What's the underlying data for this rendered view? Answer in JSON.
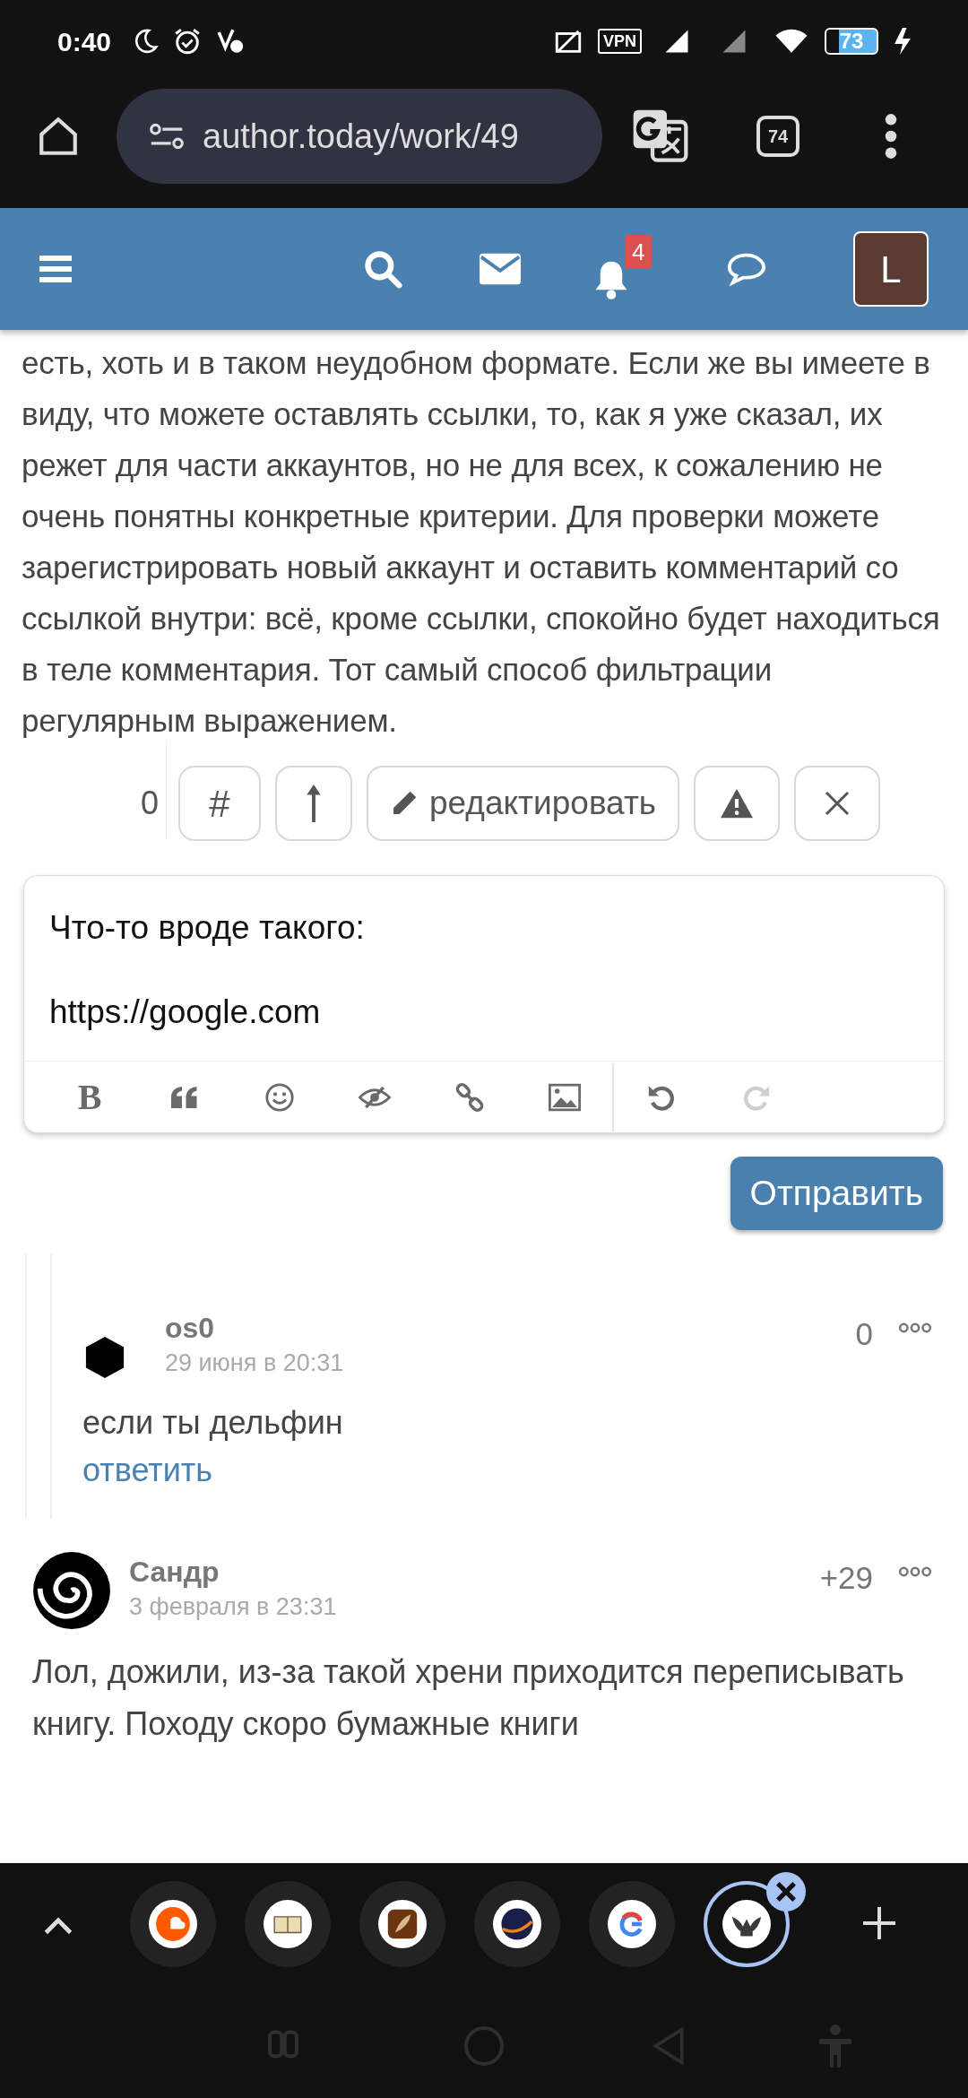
{
  "status_bar": {
    "time": "0:40",
    "vpn": "VPN",
    "battery": "73"
  },
  "browser": {
    "url": "author.today/work/49",
    "tab_count": "74"
  },
  "site_header": {
    "notification_count": "4",
    "avatar_letter": "L"
  },
  "comment_body": "есть, хоть и в таком неудобном формате. Если же вы имеете в виду, что можете оставлять ссылки, то, как я уже сказал, их режет для части аккаунтов, но не для всех, к сожалению не очень понятны конкретные критерии. Для проверки можете зарегистрировать новый аккаунт и оставить комментарий со ссылкой внутри: всё, кроме ссылки, спокойно будет находиться в теле комментария. Тот самый способ фильтрации регулярным выражением.",
  "actions": {
    "score": "0",
    "buttons": [
      {
        "kind": "hash",
        "label": "#"
      },
      {
        "kind": "pin"
      },
      {
        "kind": "edit",
        "label": "редактировать"
      },
      {
        "kind": "report"
      },
      {
        "kind": "close"
      }
    ]
  },
  "editor": {
    "value": "Что-то вроде такого:\n\nhttps://google.com",
    "tools": [
      {
        "kind": "bold",
        "label": "B",
        "disabled": false
      },
      {
        "kind": "quote",
        "disabled": false
      },
      {
        "kind": "emoji",
        "disabled": false
      },
      {
        "kind": "spoiler",
        "disabled": false
      },
      {
        "kind": "link",
        "disabled": false
      },
      {
        "kind": "image",
        "disabled": false
      },
      {
        "kind": "undo",
        "disabled": false
      },
      {
        "kind": "redo",
        "disabled": true
      }
    ]
  },
  "submit_button": "Отправить",
  "comments": [
    {
      "avatar": {
        "kind": "hexagon"
      },
      "nested": true,
      "author": "os0",
      "date": "29 июня в 20:31",
      "score": "0",
      "text": "если ты дельфин",
      "reply": "ответить"
    },
    {
      "avatar": {
        "kind": "spiral"
      },
      "nested": false,
      "author": "Сандр",
      "date": "3 февраля в 23:31",
      "score": "+29",
      "text": "Лол, дожили, из-за такой хрени приходится переписывать книгу. Походу скоро бумажные книги"
    }
  ],
  "tab_strip": {
    "tabs": [
      {
        "kind": "cloud",
        "selected": false
      },
      {
        "kind": "book",
        "selected": false
      },
      {
        "kind": "feather",
        "selected": false
      },
      {
        "kind": "monogram",
        "selected": false
      },
      {
        "kind": "g",
        "selected": false
      },
      {
        "kind": "eagle",
        "selected": true
      }
    ]
  }
}
